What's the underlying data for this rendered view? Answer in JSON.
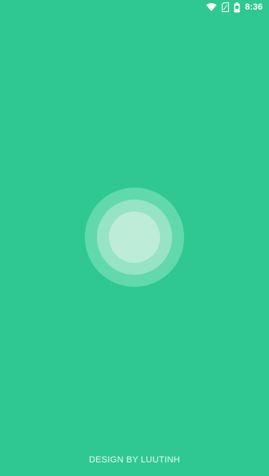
{
  "status_bar": {
    "time": "8:36",
    "icons": [
      "wifi-icon",
      "sim-card-icon",
      "battery-icon"
    ]
  },
  "footer": {
    "credit": "DESIGN BY LUUTINH"
  },
  "colors": {
    "background": "#2fc892",
    "ring_outer": "#62d8ad",
    "ring_middle": "#96e3c6",
    "ring_inner": "#bdecd9"
  }
}
